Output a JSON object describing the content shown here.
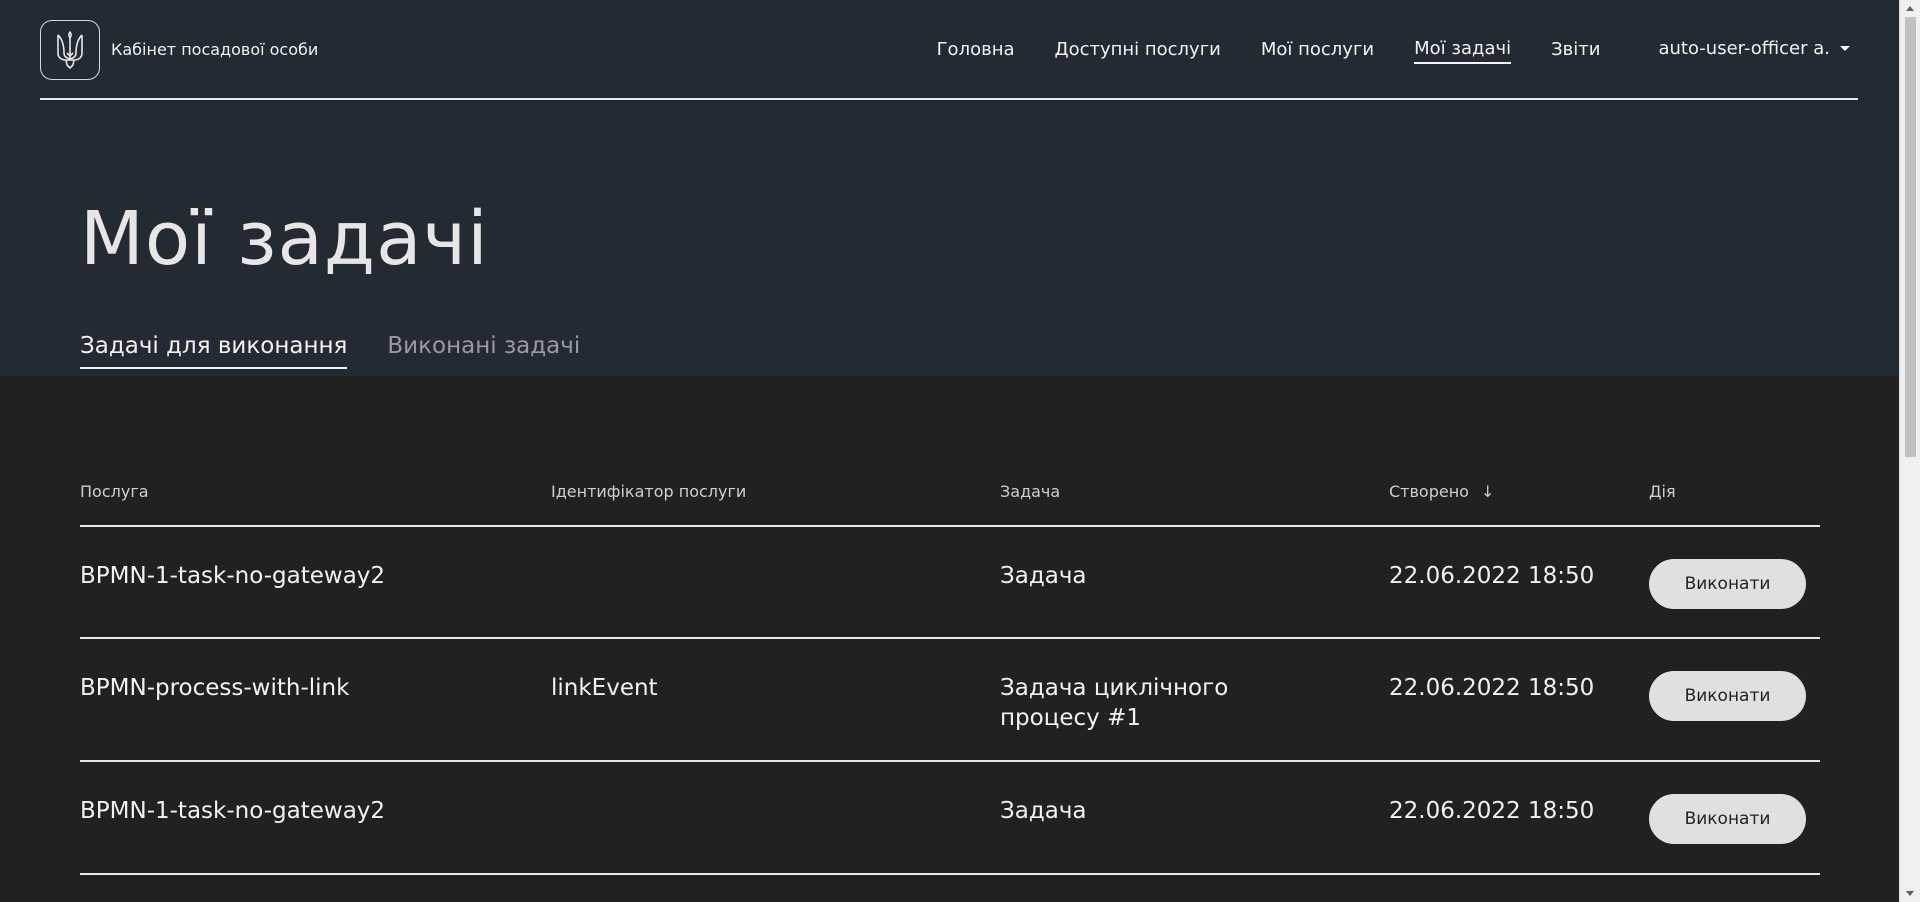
{
  "header": {
    "logo_title": "Кабінет посадової особи",
    "nav": [
      {
        "label": "Головна"
      },
      {
        "label": "Доступні послуги"
      },
      {
        "label": "Мої послуги"
      },
      {
        "label": "Мої задачі"
      },
      {
        "label": "Звіти"
      }
    ],
    "active_nav": "Мої задачі",
    "user": "auto-user-officer a."
  },
  "page": {
    "title": "Мої задачі",
    "tabs": [
      {
        "label": "Задачі для виконання",
        "active": true
      },
      {
        "label": "Виконані задачі",
        "active": false
      }
    ]
  },
  "table": {
    "columns": [
      "Послуга",
      "Ідентифікатор послуги",
      "Задача",
      "Створено",
      "Дія"
    ],
    "sort_column": "Створено",
    "sort_direction": "desc",
    "rows": [
      {
        "service": "BPMN-1-task-no-gateway2",
        "service_id": "",
        "task": "Задача",
        "created": "22.06.2022 18:50",
        "action": "Виконати"
      },
      {
        "service": "BPMN-process-with-link",
        "service_id": "linkEvent",
        "task": "Задача циклічного процесу #1",
        "created": "22.06.2022 18:50",
        "action": "Виконати"
      },
      {
        "service": "BPMN-1-task-no-gateway2",
        "service_id": "",
        "task": "Задача",
        "created": "22.06.2022 18:50",
        "action": "Виконати"
      }
    ]
  },
  "colors": {
    "hero_bg": "#232a32",
    "body_bg": "#212121",
    "button_bg": "#e0e0e0"
  },
  "icons": {
    "logo": "trident-icon",
    "user_caret": "caret-down-icon",
    "sort": "arrow-down-icon"
  }
}
